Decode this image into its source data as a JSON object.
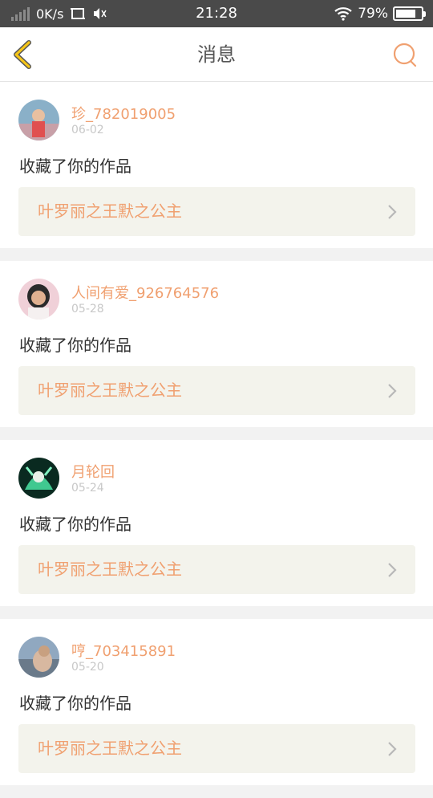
{
  "statusbar": {
    "network_speed": "0K/s",
    "time": "21:28",
    "battery_percent": "79%",
    "battery_level": 0.79
  },
  "header": {
    "title": "消息",
    "back_icon": "chevron-left-icon",
    "search_icon": "search-icon"
  },
  "colors": {
    "accent": "#f0a070",
    "back_arrow": "#f5c518",
    "card_bg": "#ffffff",
    "work_bg": "#f3f3ec"
  },
  "messages": [
    {
      "username": "珍_782019005",
      "date": "06-02",
      "action": "收藏了你的作品",
      "work_title": "叶罗丽之王默之公主"
    },
    {
      "username": "人间有爱_926764576",
      "date": "05-28",
      "action": "收藏了你的作品",
      "work_title": "叶罗丽之王默之公主"
    },
    {
      "username": "月轮回",
      "date": "05-24",
      "action": "收藏了你的作品",
      "work_title": "叶罗丽之王默之公主"
    },
    {
      "username": "哼_703415891",
      "date": "05-20",
      "action": "收藏了你的作品",
      "work_title": "叶罗丽之王默之公主"
    }
  ]
}
